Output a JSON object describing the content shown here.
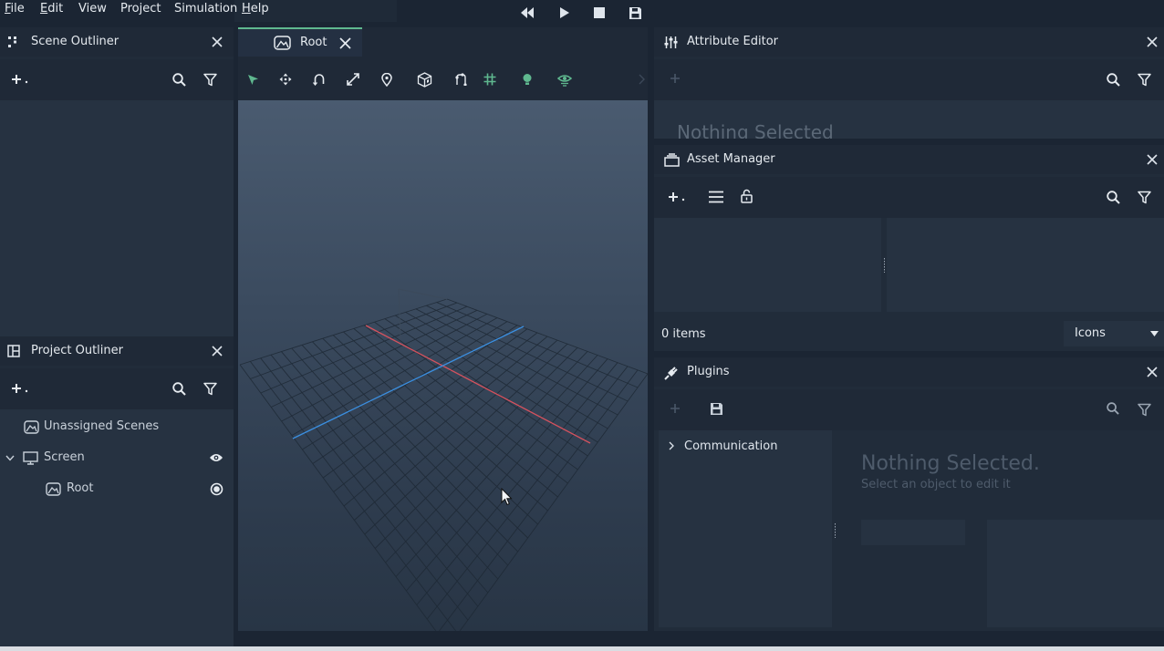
{
  "menu": {
    "file": "File",
    "edit": "Edit",
    "view": "View",
    "project": "Project",
    "simulation": "Simulation",
    "help": "Help"
  },
  "scene_outliner": {
    "title": "Scene Outliner"
  },
  "project_outliner": {
    "title": "Project Outliner",
    "items": [
      {
        "label": "Unassigned Scenes",
        "icon": "scene-icon"
      },
      {
        "label": "Screen",
        "icon": "monitor-icon"
      },
      {
        "label": "Root",
        "icon": "scene-icon"
      }
    ]
  },
  "viewport": {
    "tab_label": "Root"
  },
  "attribute_editor": {
    "title": "Attribute Editor",
    "empty_text": "Nothing Selected"
  },
  "asset_manager": {
    "title": "Asset Manager",
    "count": "0 items",
    "view_mode": "Icons"
  },
  "plugins": {
    "title": "Plugins",
    "tree_item": "Communication",
    "empty_title": "Nothing Selected.",
    "empty_subtitle": "Select an object to edit it"
  },
  "colors": {
    "accent": "#5fb88f",
    "axis_x": "#d4525e",
    "axis_z": "#3b8fe0"
  }
}
